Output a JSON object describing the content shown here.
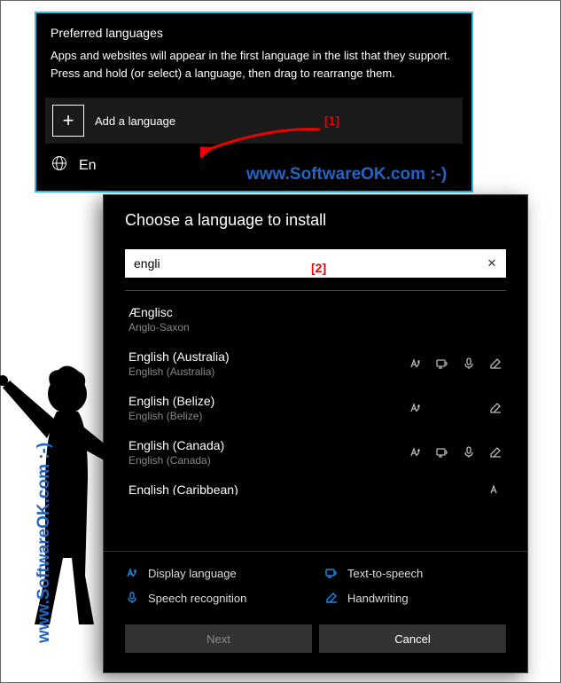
{
  "panel": {
    "heading": "Preferred languages",
    "description": "Apps and websites will appear in the first language in the list that they support. Press and hold (or select) a language, then drag to rearrange them.",
    "add_label": "Add a language",
    "existing_prefix": "En"
  },
  "dialog": {
    "title": "Choose a language to install",
    "search_value": "engli",
    "list": [
      {
        "native": "Ænglisc",
        "english": "Anglo-Saxon",
        "features": []
      },
      {
        "native": "English (Australia)",
        "english": "English (Australia)",
        "features": [
          "display",
          "tts",
          "speech",
          "hand"
        ]
      },
      {
        "native": "English (Belize)",
        "english": "English (Belize)",
        "features": [
          "display",
          "hand"
        ]
      },
      {
        "native": "English (Canada)",
        "english": "English (Canada)",
        "features": [
          "display",
          "tts",
          "speech",
          "hand"
        ]
      },
      {
        "native": "English (Caribbean)",
        "english": "",
        "features": [
          "display"
        ]
      }
    ],
    "legend": {
      "display": "Display language",
      "tts": "Text-to-speech",
      "speech": "Speech recognition",
      "hand": "Handwriting"
    },
    "buttons": {
      "next": "Next",
      "cancel": "Cancel"
    }
  },
  "annotations": {
    "a1": "[1]",
    "a2": "[2]"
  },
  "watermark": "www.SoftwareOK.com :-)"
}
